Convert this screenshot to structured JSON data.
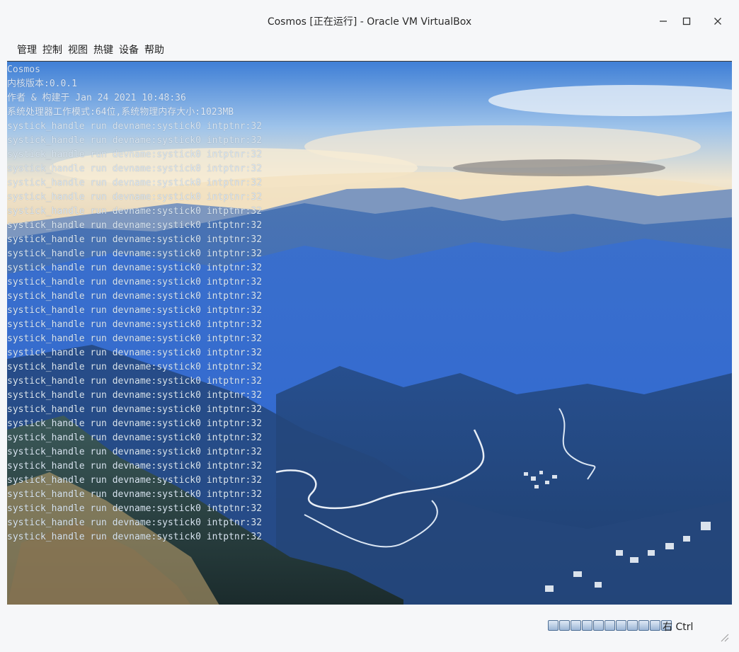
{
  "window": {
    "title": "Cosmos [正在运行] - Oracle VM VirtualBox",
    "controls": [
      "minimize",
      "maximize",
      "close"
    ]
  },
  "menu": [
    "管理",
    "控制",
    "视图",
    "热键",
    "设备",
    "帮助"
  ],
  "console": {
    "header_lines": [
      "Cosmos",
      "内核版本:0.0.1",
      "作者 & 构建于 Jan 24 2021 10:48:36",
      "系统处理器工作模式:64位,系统物理内存大小:1023MB"
    ],
    "repeated_line": "systick_handle run devname:systick0 intptnr:32",
    "repeat_count": 30
  },
  "status": {
    "host_key": "右 Ctrl",
    "icons": [
      "hard-disk-icon",
      "optical-drive-icon",
      "audio-icon",
      "network-icon",
      "usb-icon",
      "shared-folders-icon",
      "display-icon",
      "video-capture-icon",
      "cpu-icon",
      "mouse-integration-icon",
      "keyboard-icon"
    ]
  },
  "colors": {
    "chrome": "#f6f7f9",
    "sky": "#a9c7e6",
    "mountain_blue": "#2f6ad2",
    "console_text": "#d9e6f2"
  }
}
